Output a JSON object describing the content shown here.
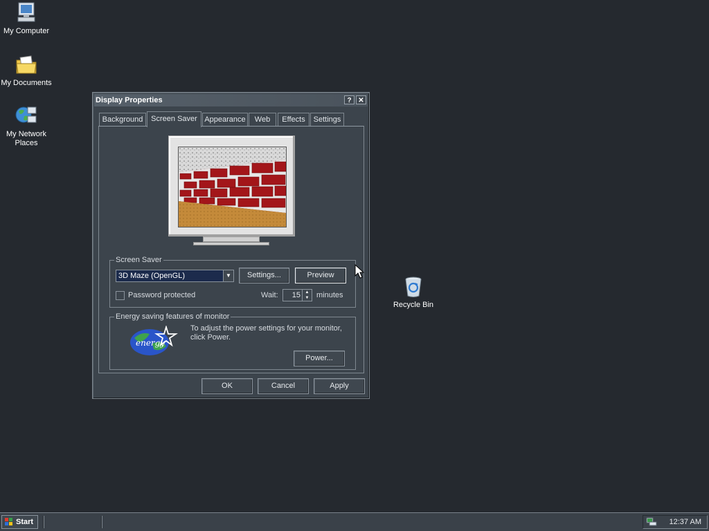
{
  "desktop": {
    "icons": [
      {
        "label": "My Computer",
        "icon": "computer-icon"
      },
      {
        "label": "My Documents",
        "icon": "documents-folder-icon"
      },
      {
        "label": "My Network Places",
        "icon": "network-places-icon"
      },
      {
        "label": "Recycle Bin",
        "icon": "recycle-bin-icon"
      }
    ]
  },
  "window": {
    "title": "Display Properties",
    "help_button": "?",
    "close_button": "✕",
    "tabs": [
      {
        "label": "Background",
        "active": false
      },
      {
        "label": "Screen Saver",
        "active": true
      },
      {
        "label": "Appearance",
        "active": false
      },
      {
        "label": "Web",
        "active": false
      },
      {
        "label": "Effects",
        "active": false
      },
      {
        "label": "Settings",
        "active": false
      }
    ],
    "screen_saver": {
      "group_label": "Screen Saver",
      "selected": "3D Maze (OpenGL)",
      "settings_button": "Settings...",
      "preview_button": "Preview",
      "password_label": "Password protected",
      "password_checked": false,
      "wait_label": "Wait:",
      "wait_value": "15",
      "wait_unit": "minutes"
    },
    "energy": {
      "group_label": "Energy saving features of monitor",
      "text": "To adjust the power settings for your monitor, click Power.",
      "power_button": "Power...",
      "logo_icon": "energy-star-logo"
    },
    "buttons": {
      "ok": "OK",
      "cancel": "Cancel",
      "apply": "Apply"
    }
  },
  "taskbar": {
    "start_label": "Start",
    "clock": "12:37 AM",
    "tray_icon": "network-tray-icon"
  },
  "colors": {
    "desktop_bg": "#25292f",
    "window_bg": "#3c444c",
    "selection_bg": "#1c2b4c"
  }
}
